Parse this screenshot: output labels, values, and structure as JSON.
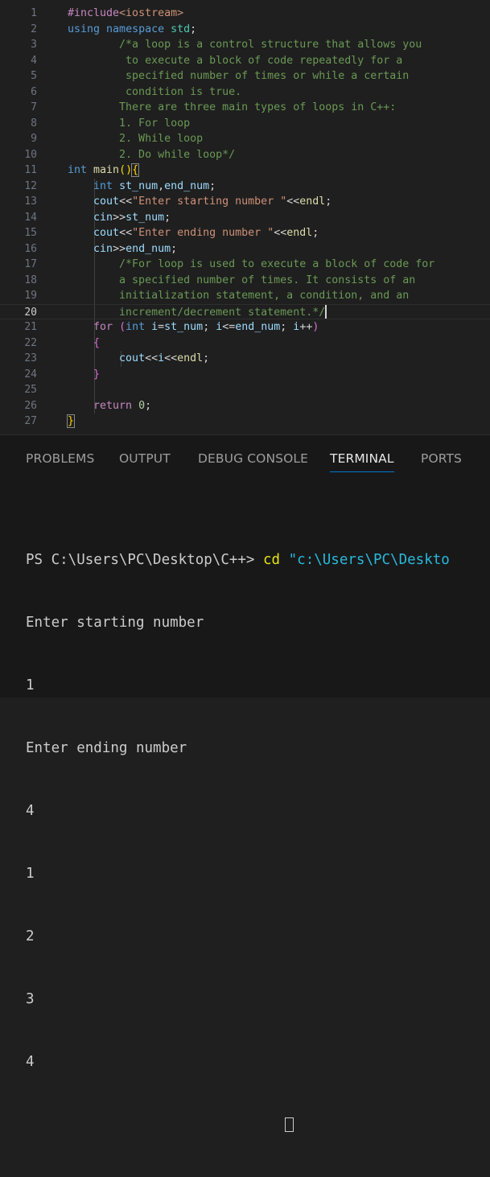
{
  "editor": {
    "active_line": 20,
    "lines": [
      {
        "n": "1",
        "segs": [
          {
            "c": "pp",
            "t": "#include"
          },
          {
            "c": "inc",
            "t": "<iostream>"
          }
        ]
      },
      {
        "n": "2",
        "segs": [
          {
            "c": "kw",
            "t": "using "
          },
          {
            "c": "kw",
            "t": "namespace "
          },
          {
            "c": "ty",
            "t": "std"
          },
          {
            "c": "op",
            "t": ";"
          }
        ]
      },
      {
        "n": "3",
        "segs": [
          {
            "c": "cm",
            "t": "        /*a loop is a control structure that allows you"
          }
        ]
      },
      {
        "n": "4",
        "segs": [
          {
            "c": "cm",
            "t": "         to execute a block of code repeatedly for a"
          }
        ]
      },
      {
        "n": "5",
        "segs": [
          {
            "c": "cm",
            "t": "         specified number of times or while a certain"
          }
        ]
      },
      {
        "n": "6",
        "segs": [
          {
            "c": "cm",
            "t": "         condition is true."
          }
        ]
      },
      {
        "n": "7",
        "segs": [
          {
            "c": "cm",
            "t": "        There are three main types of loops in C++:"
          }
        ]
      },
      {
        "n": "8",
        "segs": [
          {
            "c": "cm",
            "t": "        1. For loop"
          }
        ]
      },
      {
        "n": "9",
        "segs": [
          {
            "c": "cm",
            "t": "        2. While loop"
          }
        ]
      },
      {
        "n": "10",
        "segs": [
          {
            "c": "cm",
            "t": "        2. Do while loop*/"
          }
        ]
      },
      {
        "n": "11",
        "segs": [
          {
            "c": "kw",
            "t": "int "
          },
          {
            "c": "fn",
            "t": "main"
          },
          {
            "c": "br1",
            "t": "()"
          },
          {
            "c": "brm",
            "t": "{"
          }
        ]
      },
      {
        "n": "12",
        "segs": [
          {
            "c": "op",
            "t": "    "
          },
          {
            "c": "kw",
            "t": "int "
          },
          {
            "c": "var",
            "t": "st_num"
          },
          {
            "c": "op",
            "t": ","
          },
          {
            "c": "var",
            "t": "end_num"
          },
          {
            "c": "op",
            "t": ";"
          }
        ]
      },
      {
        "n": "13",
        "segs": [
          {
            "c": "op",
            "t": "    "
          },
          {
            "c": "var",
            "t": "cout"
          },
          {
            "c": "op",
            "t": "<<"
          },
          {
            "c": "str",
            "t": "\"Enter starting number \""
          },
          {
            "c": "op",
            "t": "<<"
          },
          {
            "c": "fn",
            "t": "endl"
          },
          {
            "c": "op",
            "t": ";"
          }
        ]
      },
      {
        "n": "14",
        "segs": [
          {
            "c": "op",
            "t": "    "
          },
          {
            "c": "var",
            "t": "cin"
          },
          {
            "c": "op",
            "t": ">>"
          },
          {
            "c": "var",
            "t": "st_num"
          },
          {
            "c": "op",
            "t": ";"
          }
        ]
      },
      {
        "n": "15",
        "segs": [
          {
            "c": "op",
            "t": "    "
          },
          {
            "c": "var",
            "t": "cout"
          },
          {
            "c": "op",
            "t": "<<"
          },
          {
            "c": "str",
            "t": "\"Enter ending number \""
          },
          {
            "c": "op",
            "t": "<<"
          },
          {
            "c": "fn",
            "t": "endl"
          },
          {
            "c": "op",
            "t": ";"
          }
        ]
      },
      {
        "n": "16",
        "segs": [
          {
            "c": "op",
            "t": "    "
          },
          {
            "c": "var",
            "t": "cin"
          },
          {
            "c": "op",
            "t": ">>"
          },
          {
            "c": "var",
            "t": "end_num"
          },
          {
            "c": "op",
            "t": ";"
          }
        ]
      },
      {
        "n": "17",
        "segs": [
          {
            "c": "cm",
            "t": "        /*For loop is used to execute a block of code for"
          }
        ]
      },
      {
        "n": "18",
        "segs": [
          {
            "c": "cm",
            "t": "        a specified number of times. It consists of an"
          }
        ]
      },
      {
        "n": "19",
        "segs": [
          {
            "c": "cm",
            "t": "        initialization statement, a condition, and an"
          }
        ]
      },
      {
        "n": "20",
        "segs": [
          {
            "c": "cm",
            "t": "        increment/decrement statement.*/"
          }
        ],
        "cursor": true
      },
      {
        "n": "21",
        "segs": [
          {
            "c": "op",
            "t": "    "
          },
          {
            "c": "pp",
            "t": "for "
          },
          {
            "c": "br2",
            "t": "("
          },
          {
            "c": "kw",
            "t": "int "
          },
          {
            "c": "var",
            "t": "i"
          },
          {
            "c": "op",
            "t": "="
          },
          {
            "c": "var",
            "t": "st_num"
          },
          {
            "c": "op",
            "t": "; "
          },
          {
            "c": "var",
            "t": "i"
          },
          {
            "c": "op",
            "t": "<="
          },
          {
            "c": "var",
            "t": "end_num"
          },
          {
            "c": "op",
            "t": "; "
          },
          {
            "c": "var",
            "t": "i"
          },
          {
            "c": "op",
            "t": "++"
          },
          {
            "c": "br2",
            "t": ")"
          }
        ]
      },
      {
        "n": "22",
        "segs": [
          {
            "c": "op",
            "t": "    "
          },
          {
            "c": "br2",
            "t": "{"
          }
        ]
      },
      {
        "n": "23",
        "segs": [
          {
            "c": "op",
            "t": "        "
          },
          {
            "c": "var",
            "t": "cout"
          },
          {
            "c": "op",
            "t": "<<"
          },
          {
            "c": "var",
            "t": "i"
          },
          {
            "c": "op",
            "t": "<<"
          },
          {
            "c": "fn",
            "t": "endl"
          },
          {
            "c": "op",
            "t": ";"
          }
        ]
      },
      {
        "n": "24",
        "segs": [
          {
            "c": "op",
            "t": "    "
          },
          {
            "c": "br2",
            "t": "}"
          }
        ]
      },
      {
        "n": "25",
        "segs": []
      },
      {
        "n": "26",
        "segs": [
          {
            "c": "op",
            "t": "    "
          },
          {
            "c": "pp",
            "t": "return "
          },
          {
            "c": "num",
            "t": "0"
          },
          {
            "c": "op",
            "t": ";"
          }
        ]
      },
      {
        "n": "27",
        "segs": [
          {
            "c": "brm",
            "t": "}"
          }
        ]
      }
    ]
  },
  "panel": {
    "tabs": [
      {
        "id": "problems",
        "label": "PROBLEMS",
        "active": false
      },
      {
        "id": "output",
        "label": "OUTPUT",
        "active": false
      },
      {
        "id": "debug-console",
        "label": "DEBUG CONSOLE",
        "active": false
      },
      {
        "id": "terminal",
        "label": "TERMINAL",
        "active": true
      },
      {
        "id": "ports",
        "label": "PORTS",
        "active": false
      }
    ]
  },
  "terminal": {
    "prompt": "PS C:\\Users\\PC\\Desktop\\C++> ",
    "command": "cd",
    "command_arg": " \"c:\\Users\\PC\\Deskto",
    "output": [
      "Enter starting number",
      "1",
      "Enter ending number",
      "4",
      "1",
      "2",
      "3",
      "4"
    ]
  },
  "colors": {
    "accent": "#0078d4",
    "comment": "#6a9955",
    "keyword": "#569cd6",
    "string": "#ce9178"
  }
}
